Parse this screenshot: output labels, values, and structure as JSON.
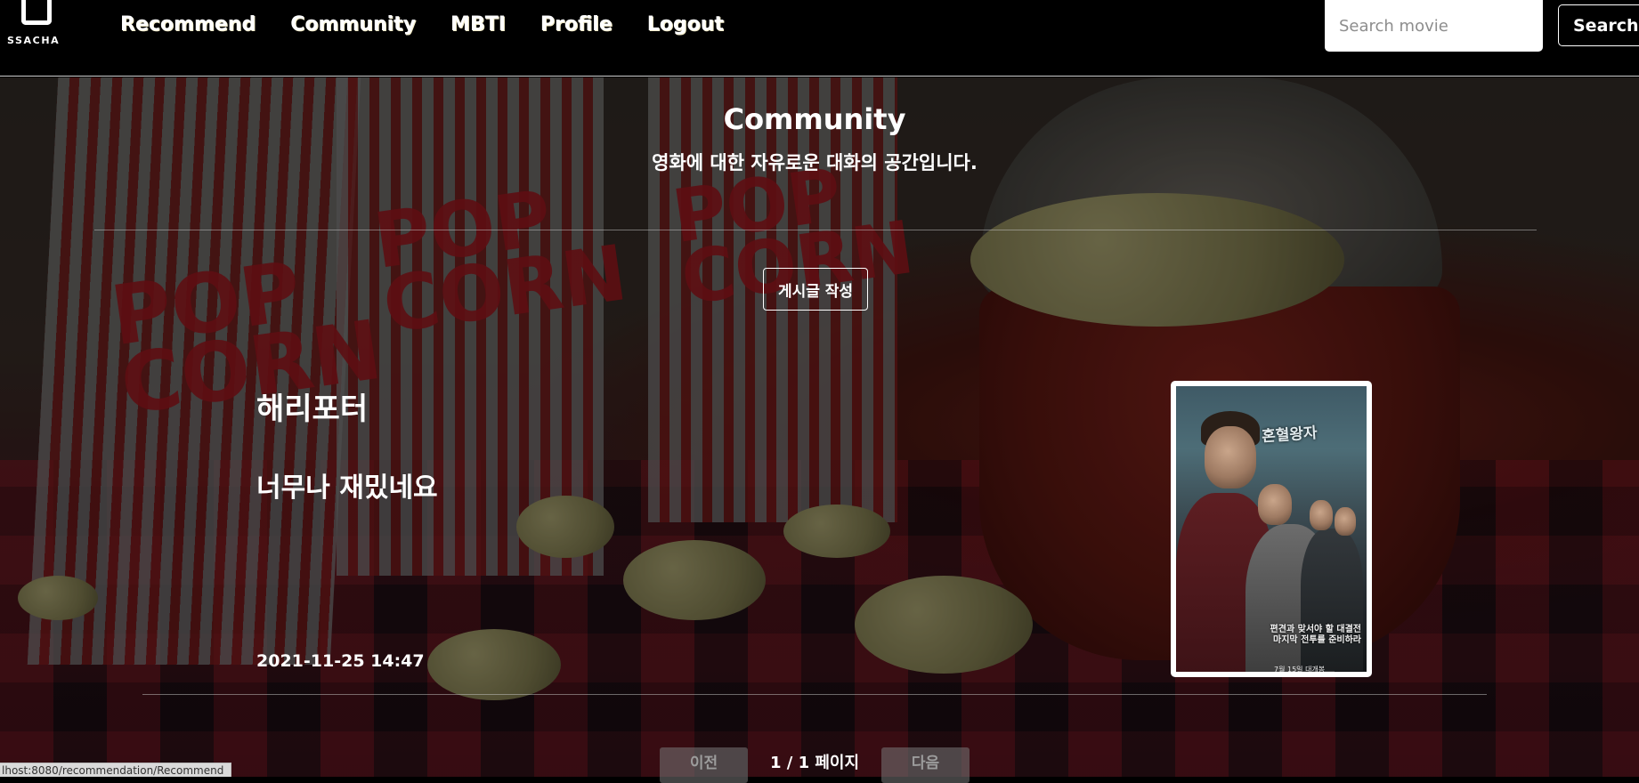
{
  "navbar": {
    "brand": "SSACHA",
    "links": [
      "Recommend",
      "Community",
      "MBTI",
      "Profile",
      "Logout"
    ],
    "search_placeholder": "Search movie",
    "search_button": "Search"
  },
  "community": {
    "title": "Community",
    "subtitle": "영화에 대한 자유로운 대화의 공간입니다.",
    "write_button": "게시글 작성"
  },
  "post": {
    "title": "해리포터",
    "body": "너무나 재밌네요",
    "date": "2021-11-25 14:47",
    "poster": {
      "title_text": "혼혈왕자",
      "caption": "편견과 맞서야 할 대결전\n마지막 전투를 준비하라",
      "big_text": "준비하라",
      "date_text": "7월 15일 대개봉"
    }
  },
  "pagination": {
    "prev": "이전",
    "status": "1 / 1 페이지",
    "next": "다음"
  },
  "browser": {
    "status_url": "lhost:8080/recommendation/Recommend"
  },
  "colors": {
    "nav_bg": "#000000",
    "text": "#ffffff",
    "accent_red": "#6e1818"
  }
}
